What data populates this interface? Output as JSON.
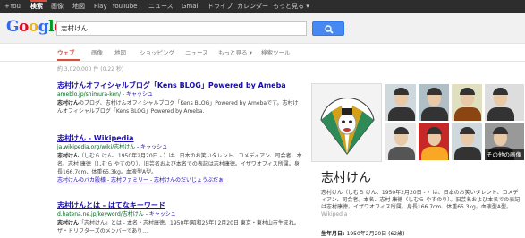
{
  "topbar": {
    "items": [
      "+You",
      "検索",
      "画像",
      "地図",
      "Play",
      "YouTube",
      "ニュース",
      "Gmail",
      "ドライブ",
      "カレンダー",
      "もっと見る ▾"
    ]
  },
  "header": {
    "logo": [
      "G",
      "o",
      "o",
      "g",
      "l",
      "e"
    ],
    "logo_colors": [
      "#3369e8",
      "#d50f25",
      "#eeb211",
      "#3369e8",
      "#009925",
      "#d50f25"
    ],
    "search_value": "志村けん"
  },
  "tabs": [
    "ウェブ",
    "画像",
    "地図",
    "ショッピング",
    "ニュース",
    "もっと見る ▾",
    "検索ツール"
  ],
  "stats": "約 3,020,000 件 (0.22 秒)",
  "results": [
    {
      "title": "志村けんオフィシャルブログ「Kens BLOG」Powered by Ameba",
      "url": "ameblo.jp/shimura-ken/",
      "cache": " - キャッシュ",
      "snippet_bold": "志村けん",
      "snippet": "のブログ、志村けんオフィシャルブログ「Kens BLOG」Powered by Amebaです。志村けんオフィシャルブログ「Kens BLOG」Powered by Ameba."
    },
    {
      "title": "志村けん - Wikipedia",
      "url": "ja.wikipedia.org/wiki/志村けん",
      "cache": " - キャッシュ",
      "snippet_bold": "志村けん",
      "snippet": "（しむら けん、1950年2月20日 - ）は、日本のお笑いタレント、コメディアン、司会者。本名、志村 康徳（しむら やすのり）。旧芸名および本名での表記は志村康徳。イザワオフィス所属。身長166.7cm、体重65.3kg。血液型A型。",
      "links": "志村けんのバカ殿様 - 志村ファミリー - 志村けんのだいじょうぶだぁ"
    },
    {
      "title": "志村けんとは - はてなキーワード",
      "url": "d.hatena.ne.jp/keyword/志村けん",
      "cache": " - キャッシュ",
      "snippet_bold": "志村けん",
      "snippet": "「志村けん」とは - 本名・志村康徳。1950年(昭和25年) 2月20日 東京・東村山市生まれ。ザ・ドリフターズのメンバーであり..."
    }
  ],
  "knowledge": {
    "title": "志村けん",
    "more_images": "その他の画像",
    "desc": "志村けん（しむら けん、1950年2月20日 - ）は、日本のお笑いタレント、コメディアン、司会者。本名、志村 康徳（しむら やすのり）。旧芸名および本名での表記は志村康徳。イザワオフィス所属。身長166.7cm、体重65.3kg。血液型A型。",
    "source": "Wikipedia",
    "birth_label": "生年月日: ",
    "birth_value": "1950年2月20日 (62歳)"
  },
  "colors": {
    "accent": "#dd4b39",
    "link": "#1a0dab",
    "url": "#006621",
    "search_button": "#4889f1"
  }
}
